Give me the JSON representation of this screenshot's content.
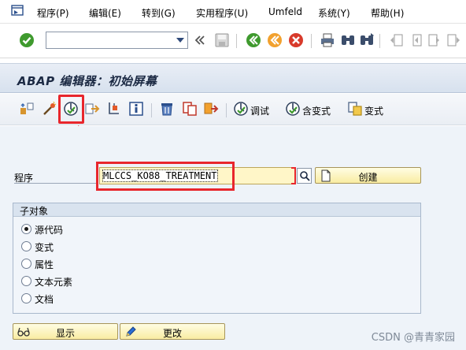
{
  "menu": {
    "items": [
      {
        "label": "程序(P)"
      },
      {
        "label": "编辑(E)"
      },
      {
        "label": "转到(G)"
      },
      {
        "label": "实用程序(U)"
      },
      {
        "label": "Umfeld"
      },
      {
        "label": "系统(Y)"
      },
      {
        "label": "帮助(H)"
      }
    ]
  },
  "toolbar": {
    "command_field_value": "",
    "icons": [
      "enter-icon",
      "save-icon",
      "back-icon",
      "exit-icon",
      "cancel-icon",
      "print-icon",
      "find-icon",
      "find-next-icon",
      "first-page-icon",
      "previous-page-icon",
      "next-page-icon"
    ]
  },
  "title": "ABAP 编辑器：初始屏幕",
  "app_toolbar": {
    "debug_label": "调试",
    "with_variant_label": "含变式",
    "variant_label": "变式"
  },
  "program": {
    "label": "程序",
    "value": "MLCCS_KO88_TREATMENT",
    "create_label": "创建"
  },
  "subobjects": {
    "title": "子对象",
    "options": [
      {
        "label": "源代码",
        "selected": true
      },
      {
        "label": "变式",
        "selected": false
      },
      {
        "label": "属性",
        "selected": false
      },
      {
        "label": "文本元素",
        "selected": false
      },
      {
        "label": "文档",
        "selected": false
      }
    ]
  },
  "buttons": {
    "display_label": "显示",
    "change_label": "更改"
  },
  "watermark": "CSDN @青青家园",
  "colors": {
    "annotation": "#e8262c",
    "input_bg": "#fff6c8",
    "button_bg": "#f9eca2"
  }
}
